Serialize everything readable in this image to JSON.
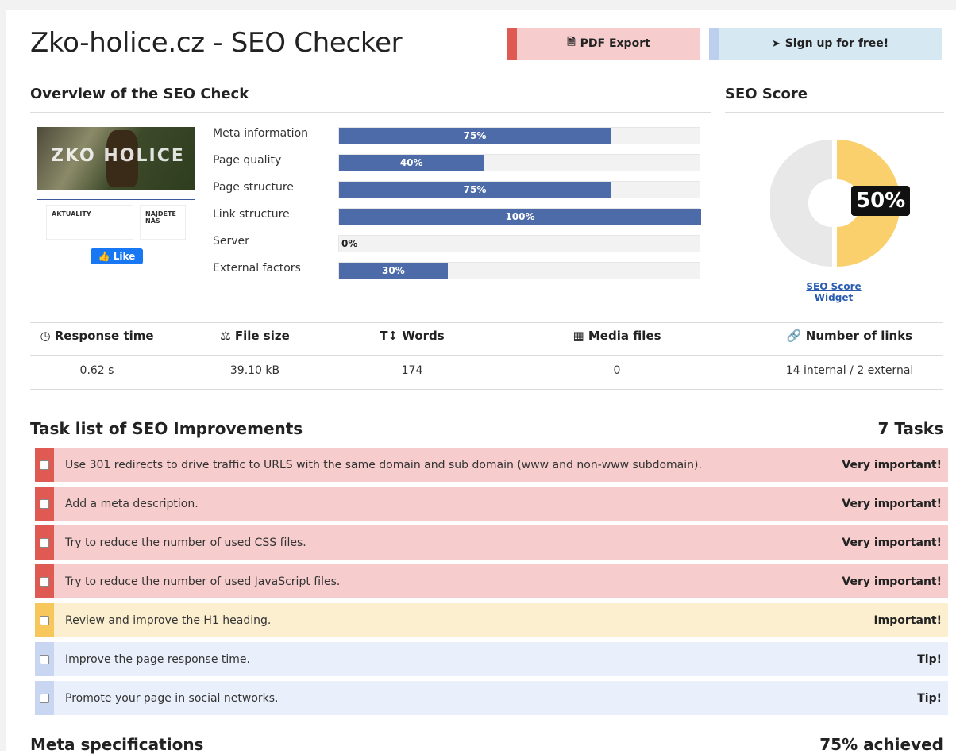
{
  "header": {
    "title": "Zko-holice.cz - SEO Checker",
    "pdf_label": "PDF Export",
    "signup_label": "Sign up for free!"
  },
  "overview": {
    "heading": "Overview of the SEO Check",
    "like_label": "Like",
    "thumbnail": {
      "logo_text": "ZKO HOLICE",
      "box_a_title": "AKTUALITY",
      "box_b_title": "NAJDETE NÁS"
    },
    "metrics": [
      {
        "label": "Meta information",
        "value": 75,
        "display": "75%"
      },
      {
        "label": "Page quality",
        "value": 40,
        "display": "40%"
      },
      {
        "label": "Page structure",
        "value": 75,
        "display": "75%"
      },
      {
        "label": "Link structure",
        "value": 100,
        "display": "100%"
      },
      {
        "label": "Server",
        "value": 0,
        "display": "0%"
      },
      {
        "label": "External factors",
        "value": 30,
        "display": "30%"
      }
    ]
  },
  "score": {
    "heading": "SEO Score",
    "value": 50,
    "display": "50%",
    "widget_link": "SEO Score Widget"
  },
  "stats": {
    "headers": [
      "Response time",
      "File size",
      "Words",
      "Media files",
      "Number of links"
    ],
    "icons": [
      "clock-icon",
      "scale-icon",
      "text-height-icon",
      "image-icon",
      "link-icon"
    ],
    "values": [
      "0.62 s",
      "39.10 kB",
      "174",
      "0",
      "14 internal / 2 external"
    ]
  },
  "tasks": {
    "heading": "Task list of SEO Improvements",
    "count": "7 Tasks",
    "items": [
      {
        "text": "Use 301 redirects to drive traffic to URLS with the same domain and sub domain (www and non-www subdomain).",
        "priority": "Very important!",
        "level": "red"
      },
      {
        "text": "Add a meta description.",
        "priority": "Very important!",
        "level": "red"
      },
      {
        "text": "Try to reduce the number of used CSS files.",
        "priority": "Very important!",
        "level": "red"
      },
      {
        "text": "Try to reduce the number of used JavaScript files.",
        "priority": "Very important!",
        "level": "red"
      },
      {
        "text": "Review and improve the H1 heading.",
        "priority": "Important!",
        "level": "yellow"
      },
      {
        "text": "Improve the page response time.",
        "priority": "Tip!",
        "level": "blue"
      },
      {
        "text": "Promote your page in social networks.",
        "priority": "Tip!",
        "level": "blue"
      }
    ]
  },
  "meta": {
    "heading": "Meta specifications",
    "achieved": "75% achieved"
  },
  "colors": {
    "bar": "#4d6ba8",
    "red": "#e05a54",
    "yellow": "#f7c75c",
    "blue": "#c9d6f2",
    "score": "#f9d06b"
  }
}
